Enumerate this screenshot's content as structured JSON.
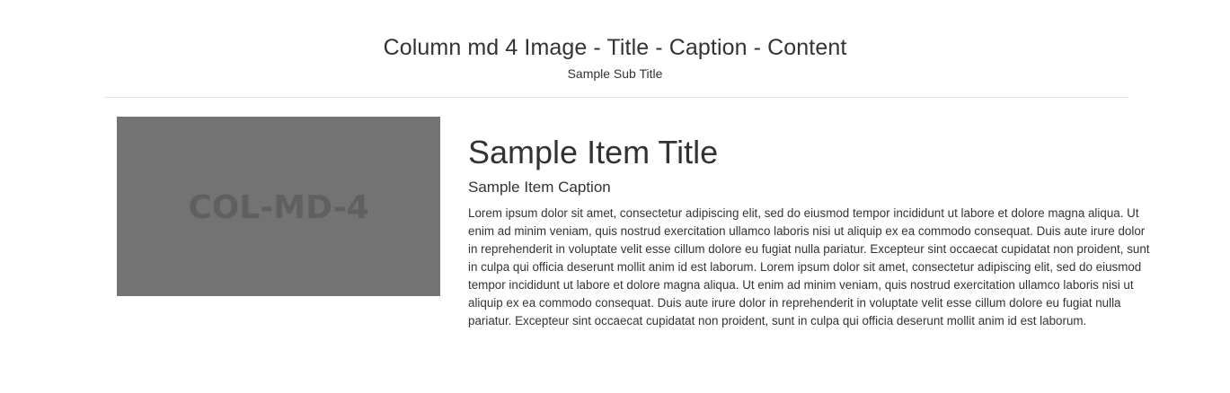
{
  "header": {
    "title": "Column md 4 Image - Title - Caption - Content",
    "subtitle": "Sample Sub Title"
  },
  "media": {
    "label": "COL-MD-4",
    "background_color": "#737373",
    "label_color": "#606060"
  },
  "item": {
    "title": "Sample Item Title",
    "caption": "Sample Item Caption",
    "body": "Lorem ipsum dolor sit amet, consectetur adipiscing elit, sed do eiusmod tempor incididunt ut labore et dolore magna aliqua. Ut enim ad minim veniam, quis nostrud exercitation ullamco laboris nisi ut aliquip ex ea commodo consequat. Duis aute irure dolor in reprehenderit in voluptate velit esse cillum dolore eu fugiat nulla pariatur. Excepteur sint occaecat cupidatat non proident, sunt in culpa qui officia deserunt mollit anim id est laborum. Lorem ipsum dolor sit amet, consectetur adipiscing elit, sed do eiusmod tempor incididunt ut labore et dolore magna aliqua. Ut enim ad minim veniam, quis nostrud exercitation ullamco laboris nisi ut aliquip ex ea commodo consequat. Duis aute irure dolor in reprehenderit in voluptate velit esse cillum dolore eu fugiat nulla pariatur. Excepteur sint occaecat cupidatat non proident, sunt in culpa qui officia deserunt mollit anim id est laborum."
  }
}
